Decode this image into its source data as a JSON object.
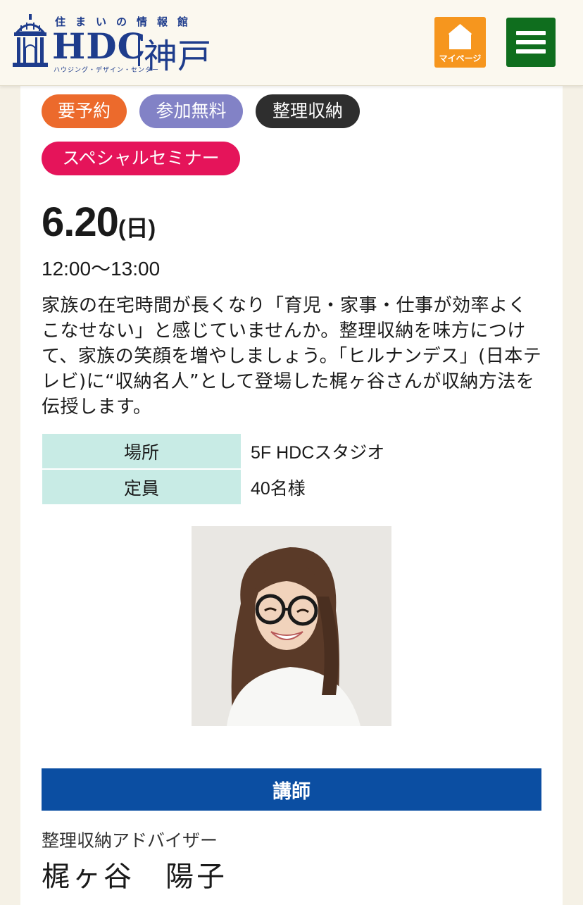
{
  "header": {
    "logo_tagline": "住まいの情報館",
    "logo_main": "HDC",
    "logo_city": "神戸",
    "logo_sub": "ハウジング・デザイン・センター",
    "mypage_label": "マイページ"
  },
  "colors": {
    "logo_blue": "#1e3c8c",
    "mypage_orange": "#f6961e",
    "menu_green": "#0f6e1e",
    "tag_reserve": "#ec6a2c",
    "tag_free": "#8282c6",
    "tag_storage": "#2e2e2e",
    "tag_special": "#e5145a",
    "table_header": "#c8ebe5",
    "lecturer_bar": "#0b4ea2"
  },
  "tags": {
    "reserve": "要予約",
    "free": "参加無料",
    "category": "整理収納",
    "special": "スペシャルセミナー"
  },
  "event": {
    "date": "6.20",
    "weekday": "(日)",
    "time": "12:00〜13:00",
    "description": "家族の在宅時間が長くなり「育児・家事・仕事が効率よくこなせない」と感じていませんか。整理収納を味方につけて、家族の笑顔を増やしましょう。「ヒルナンデス」(日本テレビ)に“収納名人”として登場した梶ヶ谷さんが収納方法を伝授します。"
  },
  "info": [
    {
      "label": "場所",
      "value": "5F HDCスタジオ"
    },
    {
      "label": "定員",
      "value": "40名様"
    }
  ],
  "lecturer": {
    "section_title": "講師",
    "title": "整理収納アドバイザー",
    "name": "梶ヶ谷　陽子"
  },
  "icons": {
    "mypage": "house-icon",
    "menu": "hamburger-menu-icon",
    "logo": "pavilion-logo-icon"
  }
}
